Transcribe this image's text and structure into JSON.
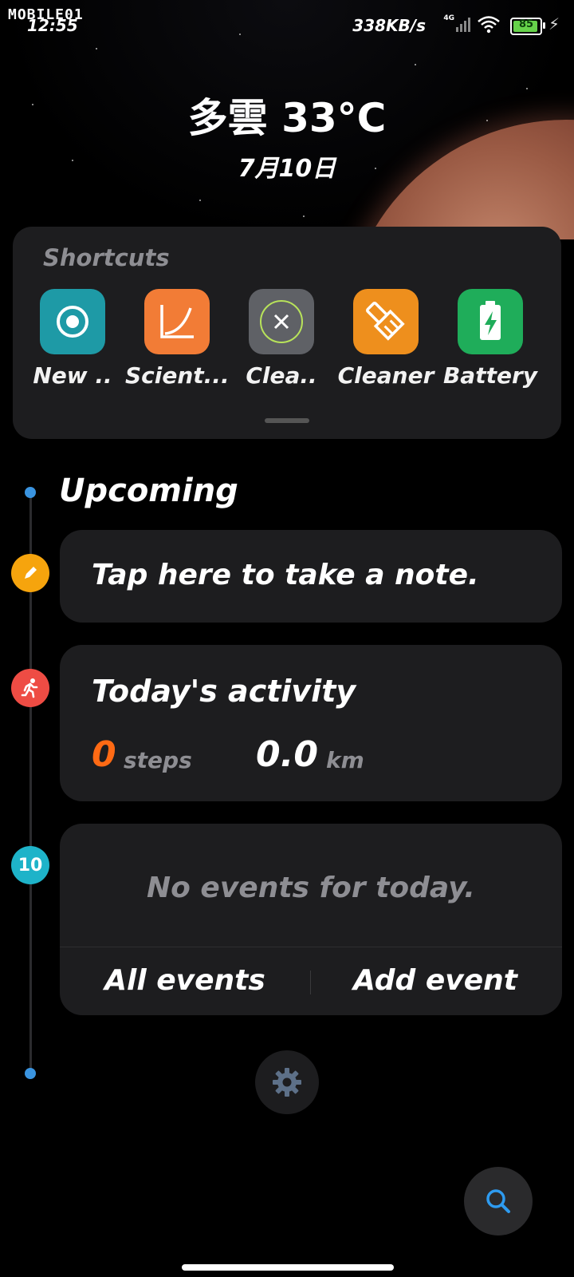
{
  "status_bar": {
    "watermark": "MOBILE01",
    "time": "12:55",
    "net_speed": "338KB/s",
    "network": "4G",
    "battery": "85"
  },
  "weather": {
    "condition_temp": "多雲 33°C",
    "date": "7月10日"
  },
  "shortcuts": {
    "title": "Shortcuts",
    "items": [
      {
        "label": "New ..",
        "icon": "record-icon",
        "color": "#1e9aa6"
      },
      {
        "label": "Scient...",
        "icon": "graph-icon",
        "color": "#f27c36"
      },
      {
        "label": "Clea..",
        "icon": "clear-icon",
        "color": "#5f6166"
      },
      {
        "label": "Cleaner",
        "icon": "broom-icon",
        "color": "#ee8f1d"
      },
      {
        "label": "Battery",
        "icon": "battery-icon",
        "color": "#1fad5a"
      }
    ]
  },
  "timeline": {
    "heading": "Upcoming",
    "note_prompt": "Tap here to take a note.",
    "activity": {
      "title": "Today's activity",
      "steps": "0",
      "steps_unit": "steps",
      "distance": "0.0",
      "distance_unit": "km"
    },
    "events": {
      "day_badge": "10",
      "empty_text": "No events for today.",
      "all_events": "All events",
      "add_event": "Add event"
    }
  },
  "colors": {
    "note_badge": "#f6a40d",
    "activity_badge": "#ee4c44",
    "events_badge": "#1eb3c9",
    "accent_blue": "#3a94e0",
    "steps_orange": "#ff6a14"
  }
}
